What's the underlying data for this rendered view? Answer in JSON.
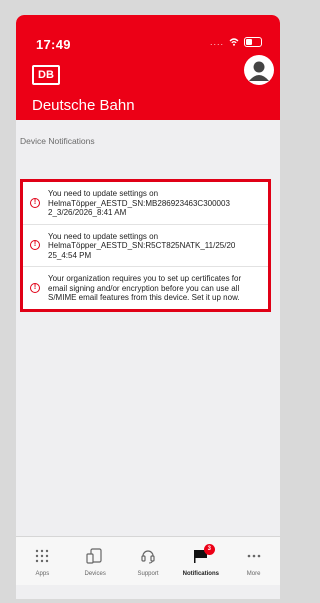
{
  "status_bar": {
    "time": "17:49",
    "signal": "...."
  },
  "header": {
    "logo": "DB",
    "brand": "Deutsche Bahn"
  },
  "section": {
    "label": "Device Notifications"
  },
  "notifications": [
    {
      "text": "You need to update settings on HelmaTöpper_AESTD_SN:MB286923463C300003 2_3/26/2026_8:41 AM"
    },
    {
      "text": "You need to update settings on HelmaTöpper_AESTD_SN:R5CT825NATK_11/25/20 25_4:54 PM"
    },
    {
      "text": "Your organization requires you to set up certificates for email signing and/or encryption before you can use all S/MIME email features from this device. Set it up now."
    }
  ],
  "tabs": [
    {
      "label": "Apps",
      "icon": "apps-grid-icon"
    },
    {
      "label": "Devices",
      "icon": "devices-icon"
    },
    {
      "label": "Support",
      "icon": "support-icon"
    },
    {
      "label": "Notifications",
      "icon": "flag-icon",
      "badge": "3",
      "active": true
    },
    {
      "label": "More",
      "icon": "more-icon"
    }
  ],
  "colors": {
    "brand_red": "#ec0016",
    "highlight_border": "#e00016"
  }
}
